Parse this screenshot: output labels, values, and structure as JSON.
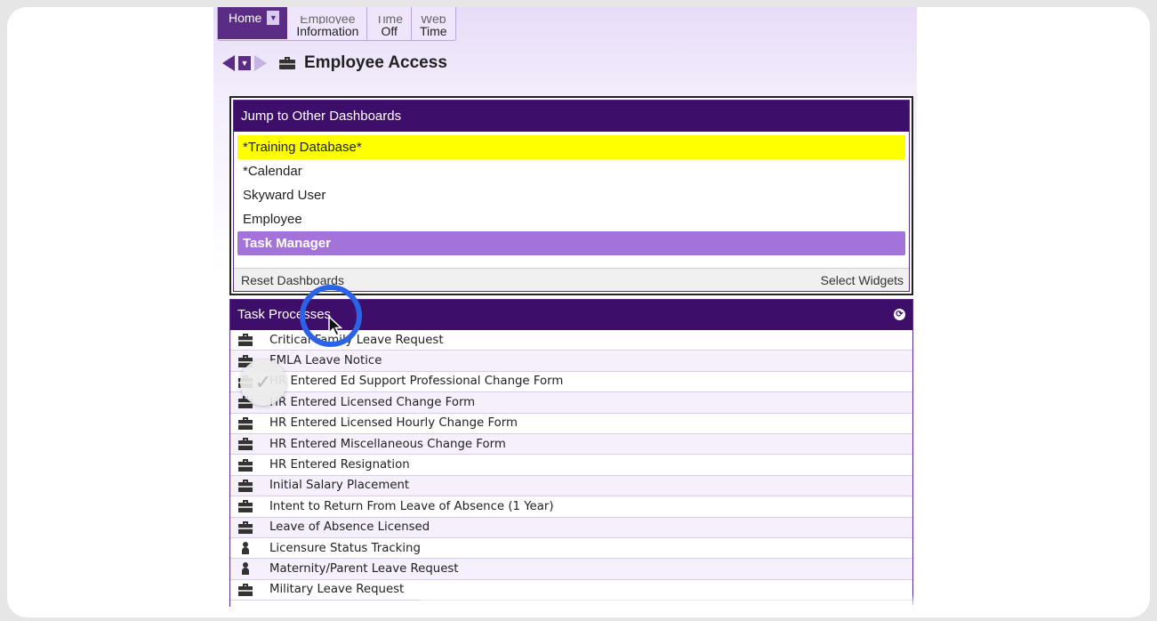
{
  "topnav": {
    "home_label": "Home",
    "tabs": [
      {
        "line1": "Employee",
        "line2": "Information"
      },
      {
        "line1": "Time",
        "line2": "Off"
      },
      {
        "line1": "Web",
        "line2": "Time"
      }
    ]
  },
  "page": {
    "title": "Employee Access"
  },
  "jump_panel": {
    "title": "Jump to Other Dashboards",
    "items": [
      {
        "label": "*Training Database*"
      },
      {
        "label": "*Calendar"
      },
      {
        "label": "Skyward User"
      },
      {
        "label": "Employee"
      },
      {
        "label": "Task Manager"
      }
    ],
    "reset_label": "Reset Dashboards",
    "select_label": "Select Widgets"
  },
  "task_panel": {
    "title": "Task Processes",
    "rows": [
      {
        "label": "Critical Family Leave Request",
        "icon": "briefcase-icon"
      },
      {
        "label": "FMLA Leave Notice",
        "icon": "briefcase-icon"
      },
      {
        "label": "HR Entered Ed Support Professional Change Form",
        "icon": "briefcase-icon"
      },
      {
        "label": "HR Entered Licensed Change Form",
        "icon": "briefcase-icon"
      },
      {
        "label": "HR Entered Licensed Hourly Change Form",
        "icon": "briefcase-icon"
      },
      {
        "label": "HR Entered Miscellaneous Change Form",
        "icon": "briefcase-icon"
      },
      {
        "label": "HR Entered Resignation",
        "icon": "briefcase-icon"
      },
      {
        "label": "Initial Salary Placement",
        "icon": "briefcase-icon"
      },
      {
        "label": "Intent to Return From Leave of Absence (1 Year)",
        "icon": "briefcase-icon"
      },
      {
        "label": "Leave of Absence Licensed",
        "icon": "briefcase-icon"
      },
      {
        "label": "Licensure Status Tracking",
        "icon": "person-icon"
      },
      {
        "label": "Maternity/Parent Leave Request",
        "icon": "person-icon"
      },
      {
        "label": "Military Leave Request",
        "icon": "briefcase-icon"
      }
    ]
  },
  "colors": {
    "brand_purple": "#3d0f6a",
    "highlight_yellow": "#ffff00",
    "selected_purple": "#a473d9",
    "click_ring": "#2b63e8"
  }
}
